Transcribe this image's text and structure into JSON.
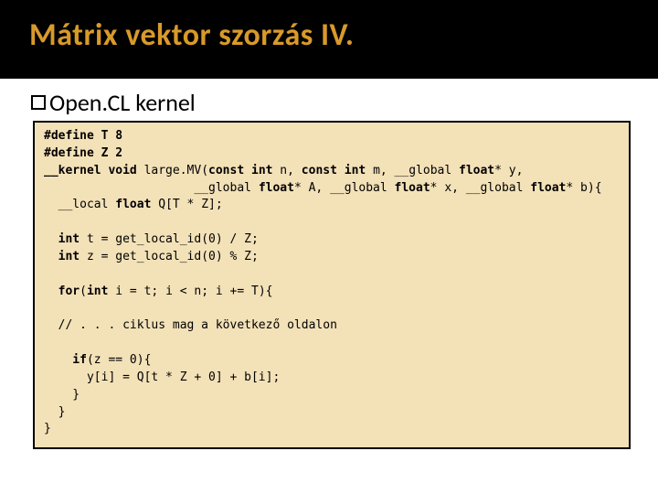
{
  "title": "Mátrix vektor szorzás IV.",
  "subtitle": "Open.CL kernel",
  "code": {
    "l1": "#define T 8",
    "l2": "#define Z 2",
    "l3a": "__kernel void",
    "l3b": " large.MV(",
    "l3c": "const int",
    "l3d": " n, ",
    "l3e": "const int",
    "l3f": " m, __global ",
    "l3g": "float",
    "l3h": "* y,",
    "l4a": "                     __global ",
    "l4b": "float",
    "l4c": "* A, __global ",
    "l4d": "float",
    "l4e": "* x, __global ",
    "l4f": "float",
    "l4g": "* b){",
    "l5a": "  __local ",
    "l5b": "float",
    "l5c": " Q[T * Z];",
    "blank1": "",
    "l6a": "  int",
    "l6b": " t = get_local_id(0) / Z;",
    "l7a": "  int",
    "l7b": " z = get_local_id(0) % Z;",
    "blank2": "",
    "l8a": "  for",
    "l8b": "(",
    "l8c": "int",
    "l8d": " i = t; i < n; i += T){",
    "blank3": "",
    "l9": "  // . . . ciklus mag a következő oldalon",
    "blank4": "",
    "l10a": "    if",
    "l10b": "(z == 0){",
    "l11": "      y[i] = Q[t * Z + 0] + b[i];",
    "l12": "    }",
    "l13": "  }",
    "l14": "}"
  }
}
